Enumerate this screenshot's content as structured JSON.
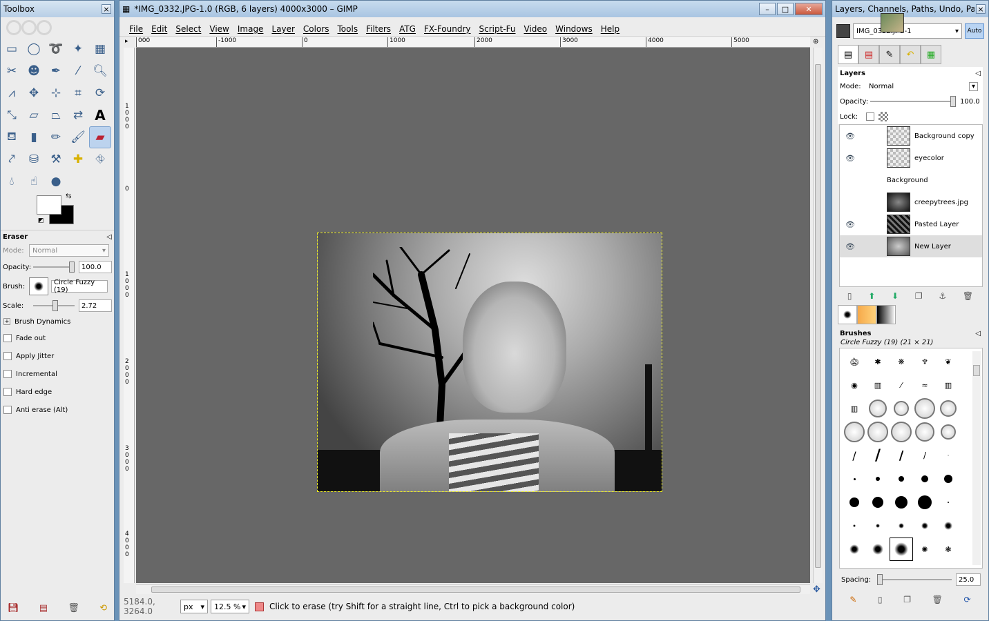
{
  "toolbox": {
    "title": "Toolbox",
    "tool_icons": [
      "rect-select",
      "ellipse-select",
      "free-select",
      "fuzzy-select",
      "select-by-color",
      "scissors",
      "foreground-select",
      "paths",
      "color-picker",
      "zoom",
      "measure",
      "move",
      "align",
      "crop",
      "rotate",
      "scale",
      "shear",
      "perspective",
      "flip",
      "text",
      "bucket-fill",
      "blend",
      "pencil",
      "paintbrush",
      "eraser",
      "airbrush",
      "ink",
      "clone",
      "heal",
      "perspective-clone",
      "blur",
      "smudge",
      "dodge-burn"
    ],
    "tool_options": {
      "title": "Eraser",
      "mode_label": "Mode:",
      "mode_value": "Normal",
      "opacity_label": "Opacity:",
      "opacity_value": "100.0",
      "brush_label": "Brush:",
      "brush_value": "Circle Fuzzy (19)",
      "scale_label": "Scale:",
      "scale_value": "2.72",
      "brush_dynamics": "Brush Dynamics",
      "checkboxes": [
        "Fade out",
        "Apply Jitter",
        "Incremental",
        "Hard edge",
        "Anti erase  (Alt)"
      ]
    }
  },
  "image_window": {
    "title": "*IMG_0332.JPG-1.0 (RGB, 6 layers) 4000x3000 – GIMP",
    "menu": [
      "File",
      "Edit",
      "Select",
      "View",
      "Image",
      "Layer",
      "Colors",
      "Tools",
      "Filters",
      "ATG",
      "FX-Foundry",
      "Script-Fu",
      "Video",
      "Windows",
      "Help"
    ],
    "hruler_labels": [
      "000",
      "-1000",
      "0",
      "1000",
      "2000",
      "3000",
      "4000",
      "5000"
    ],
    "vruler_labels": [
      "1000",
      "0",
      "1000",
      "2000",
      "3000",
      "4000"
    ],
    "status": {
      "coords": "5184.0, 3264.0",
      "unit": "px",
      "zoom": "12.5 %",
      "message": "Click to erase (try Shift for a straight line, Ctrl to pick a background color)"
    }
  },
  "dock": {
    "title": "Layers, Channels, Paths, Undo, Pale...",
    "image_combo": "IMG_0332.JPG-1",
    "auto_label": "Auto",
    "layers_panel": {
      "title": "Layers",
      "mode_label": "Mode:",
      "mode_value": "Normal",
      "opacity_label": "Opacity:",
      "opacity_value": "100.0",
      "lock_label": "Lock:",
      "layers": [
        {
          "name": "Background copy",
          "visible": true
        },
        {
          "name": "eyecolor",
          "visible": true
        },
        {
          "name": "Background",
          "visible": false
        },
        {
          "name": "creepytrees.jpg",
          "visible": false
        },
        {
          "name": "Pasted Layer",
          "visible": true
        },
        {
          "name": "New Layer",
          "visible": true
        }
      ]
    },
    "brushes_panel": {
      "title": "Brushes",
      "selected": "Circle Fuzzy (19) (21 × 21)",
      "spacing_label": "Spacing:",
      "spacing_value": "25.0"
    }
  }
}
